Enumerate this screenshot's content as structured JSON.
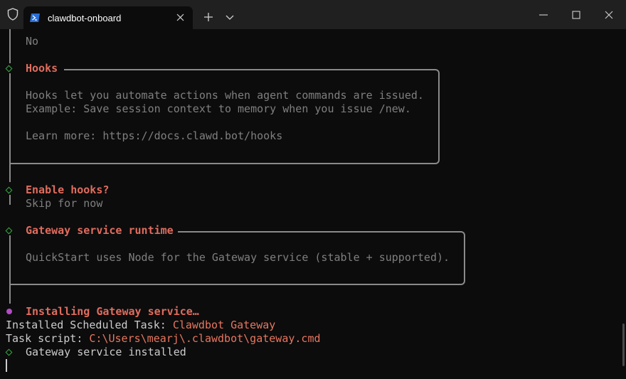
{
  "tab": {
    "title": "clawdbot-onboard"
  },
  "icons": {
    "shield": "shield-icon",
    "powershell": "powershell-icon",
    "close": "close-icon",
    "new_tab": "plus-icon",
    "dropdown": "chevron-down-icon",
    "minimize": "minimize-icon",
    "maximize": "maximize-icon",
    "window_close": "close-icon"
  },
  "terminal": {
    "prev_answer": "No",
    "hooks": {
      "heading": "Hooks",
      "line1": "Hooks let you automate actions when agent commands are issued.",
      "line2": "Example: Save session context to memory when you issue /new.",
      "line3": "Learn more: https://docs.clawd.bot/hooks"
    },
    "enable_hooks": {
      "question": "Enable hooks?",
      "answer": "Skip for now"
    },
    "gateway_runtime": {
      "heading": "Gateway service runtime",
      "line1": "QuickStart uses Node for the Gateway service (stable + supported)."
    },
    "installing": "Installing Gateway service…",
    "task_label": "Installed Scheduled Task: ",
    "task_name": "Clawdbot Gateway",
    "script_label": "Task script: ",
    "script_path": "C:\\Users\\mearj\\.clawdbot\\gateway.cmd",
    "installed": "Gateway service installed"
  },
  "colors": {
    "background": "#0c0c0c",
    "titlebar": "#202020",
    "heading_red": "#e06c5e",
    "diamond_green": "#2fae3f",
    "spinner_purple": "#b24cc6"
  }
}
